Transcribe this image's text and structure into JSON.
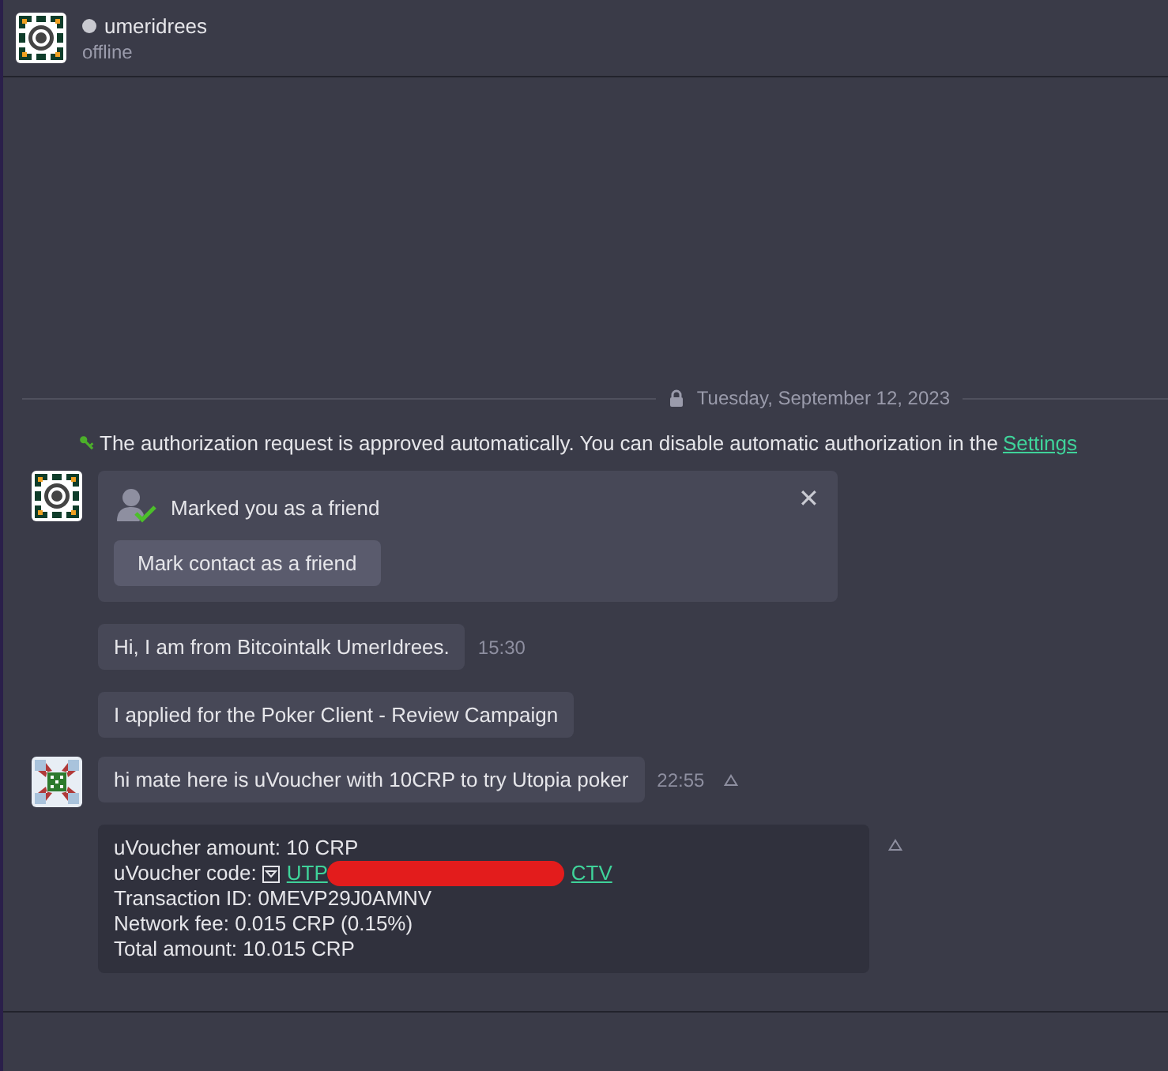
{
  "contact": {
    "name": "umeridrees",
    "status": "offline",
    "online": false
  },
  "date_divider": "Tuesday, September 12, 2023",
  "system_note": {
    "text": "The authorization request is approved automatically. You can disable automatic authorization in the",
    "link": "Settings"
  },
  "groups": [
    {
      "kind": "contact",
      "messages": [
        {
          "kind": "friend_request",
          "title": "Marked you as a friend",
          "button": "Mark contact as a friend",
          "close": "✕"
        },
        {
          "kind": "text",
          "text": "Hi, I am from Bitcointalk UmerIdrees.",
          "time": "15:30",
          "alert": false
        },
        {
          "kind": "text",
          "text": "I applied for the Poker Client - Review Campaign",
          "alert": false
        }
      ]
    },
    {
      "kind": "me",
      "messages": [
        {
          "kind": "text",
          "text": "hi mate here is uVoucher with 10CRP to try Utopia poker",
          "time": "22:55",
          "alert": true
        },
        {
          "kind": "voucher",
          "alert": true,
          "lines": [
            {
              "kind": "plain",
              "text": "uVoucher amount: 10 CRP"
            },
            {
              "kind": "code",
              "label": "uVoucher code:",
              "code_start": "UTP",
              "code_end": "CTV",
              "redacted": true
            },
            {
              "kind": "plain",
              "text": "Transaction ID: 0MEVP29J0AMNV"
            },
            {
              "kind": "plain",
              "text": "Network fee: 0.015 CRP (0.15%)"
            },
            {
              "kind": "plain",
              "text": "Total amount: 10.015 CRP"
            }
          ]
        }
      ]
    }
  ]
}
